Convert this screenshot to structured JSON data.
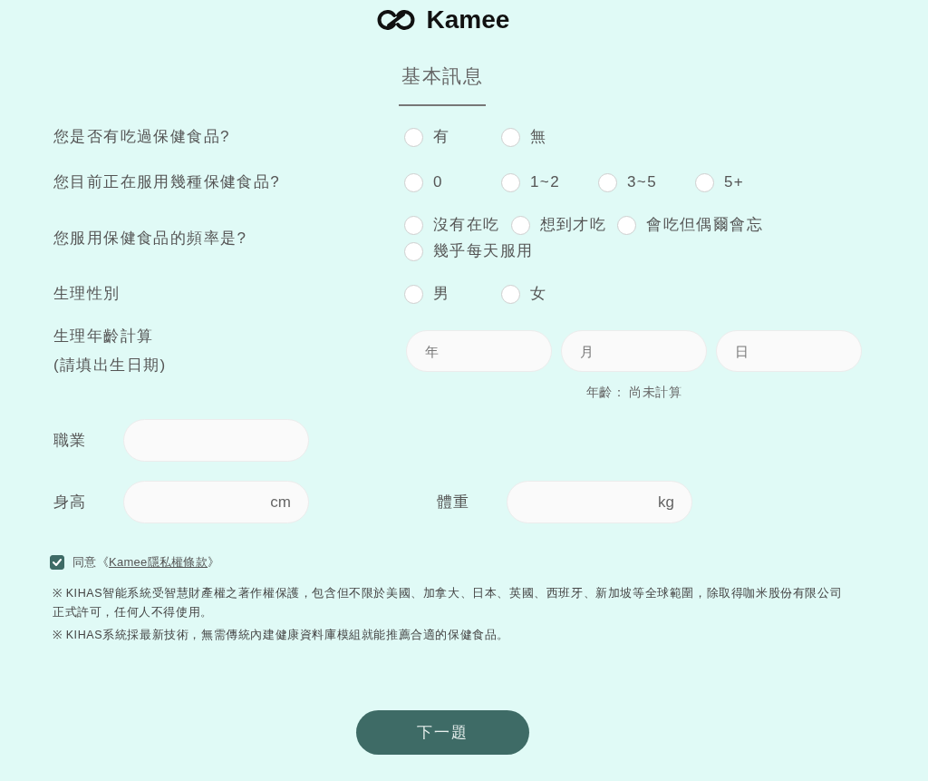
{
  "logo": {
    "text": "Kamee"
  },
  "section": {
    "title": "基本訊息"
  },
  "questions": [
    {
      "kind": "radio",
      "label": "您是否有吃過保健食品?",
      "options": [
        {
          "label": "有",
          "selected": false
        },
        {
          "label": "無",
          "selected": false
        }
      ]
    },
    {
      "kind": "radio",
      "label": "您目前正在服用幾種保健食品?",
      "options": [
        {
          "label": "0",
          "selected": false
        },
        {
          "label": "1~2",
          "selected": false
        },
        {
          "label": "3~5",
          "selected": false
        },
        {
          "label": "5+",
          "selected": false
        }
      ]
    },
    {
      "kind": "radio",
      "label": "您服用保健食品的頻率是?",
      "options": [
        {
          "label": "沒有在吃",
          "selected": false
        },
        {
          "label": "想到才吃",
          "selected": false
        },
        {
          "label": "會吃但偶爾會忘",
          "selected": false
        },
        {
          "label": "幾乎每天服用",
          "selected": false
        }
      ]
    },
    {
      "kind": "radio",
      "label": "生理性別",
      "options": [
        {
          "label": "男",
          "selected": false
        },
        {
          "label": "女",
          "selected": false
        }
      ]
    },
    {
      "kind": "date",
      "label": "生理年齡計算",
      "hint": "(請填出生日期)",
      "fields": [
        {
          "placeholder": "年"
        },
        {
          "placeholder": "月"
        },
        {
          "placeholder": "日"
        }
      ],
      "result": "年齡： 尚未計算"
    }
  ],
  "detail_rows": [
    {
      "fields": [
        {
          "kind": "text",
          "label": "職業"
        }
      ]
    },
    {
      "fields": [
        {
          "kind": "measure",
          "label": "身高",
          "unit": "cm"
        },
        {
          "kind": "measure",
          "label": "體重",
          "unit": "kg"
        }
      ]
    }
  ],
  "consent": {
    "checked": true,
    "text_before": "同意《",
    "link": "Kamee隱私權條款",
    "text_after": "》"
  },
  "notes": [
    "※ KIHAS智能系統受智慧財產權之著作權保護，包含但不限於美國、加拿大、日本、英國、西班牙、新加坡等全球範圍，除取得咖米股份有限公司正式許可，任何人不得使用。",
    "※ KIHAS系統採最新技術，無需傳統內建健康資料庫模組就能推薦合適的保健食品。"
  ],
  "next_button": {
    "label": "下一題"
  }
}
